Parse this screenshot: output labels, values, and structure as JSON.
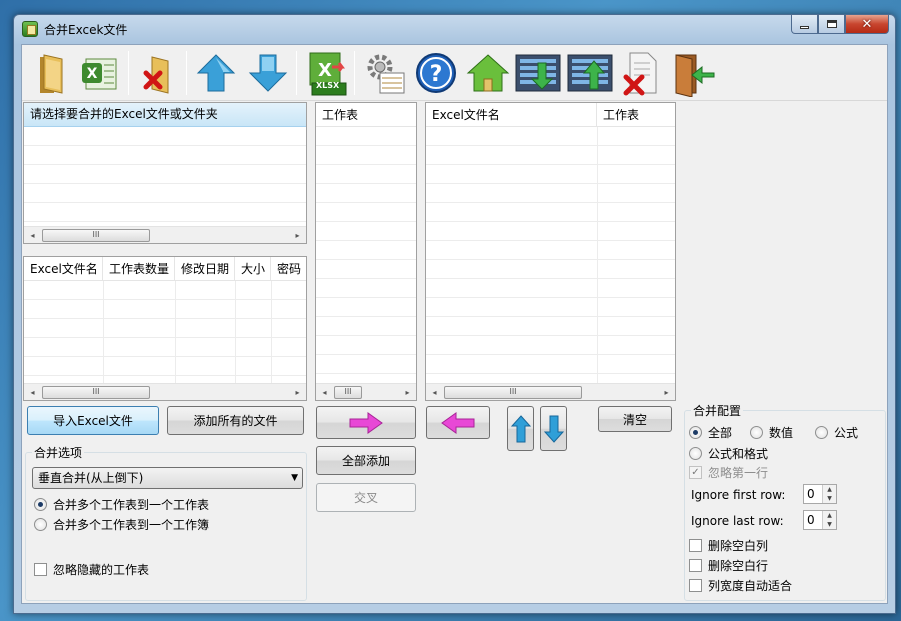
{
  "window": {
    "title": "合并Excek文件"
  },
  "toolbar": {
    "icons": [
      "open-folder-icon",
      "excel-icon",
      "remove-folder-icon",
      "move-up-icon",
      "move-down-icon",
      "xlsx-icon",
      "settings-icon",
      "help-icon",
      "home-icon",
      "import-list-icon",
      "export-list-icon",
      "delete-file-icon",
      "exit-icon"
    ],
    "xlsx_label": "XLSX"
  },
  "source_tree": {
    "prompt": "请选择要合并的Excel文件或文件夹"
  },
  "file_table": {
    "columns": [
      "Excel文件名",
      "工作表数量",
      "修改日期",
      "大小",
      "密码"
    ]
  },
  "sheet_list": {
    "column": "工作表"
  },
  "merge_list": {
    "columns": [
      "Excel文件名",
      "工作表"
    ]
  },
  "scroll": {
    "thumb_glyph": "III",
    "left": "◂",
    "right": "▸"
  },
  "buttons": {
    "import_excel": "导入Excel文件",
    "add_all_files": "添加所有的文件",
    "add_all": "全部添加",
    "intersect": "交叉",
    "clear": "清空"
  },
  "merge_options": {
    "title": "合并选项",
    "mode_selected": "垂直合并(从上倒下)",
    "radio_sheets_to_sheet": "合并多个工作表到一个工作表",
    "radio_sheets_to_book": "合并多个工作表到一个工作簿",
    "ignore_hidden": "忽略隐藏的工作表"
  },
  "merge_config": {
    "title": "合并配置",
    "radio_all": "全部",
    "radio_value": "数值",
    "radio_formula": "公式",
    "radio_formula_format": "公式和格式",
    "ignore_first_row": "忽略第一行",
    "ignore_first_label": "Ignore first row:",
    "ignore_first_value": "0",
    "ignore_last_label": "Ignore last row:",
    "ignore_last_value": "0",
    "delete_empty_cols": "删除空白列",
    "delete_empty_rows": "删除空白行",
    "autofit_width": "列宽度自动适合"
  },
  "colors": {
    "accent": "#3c7fb1",
    "arrow_pink": "#e848d6",
    "arrow_blue": "#2f9fd8"
  }
}
